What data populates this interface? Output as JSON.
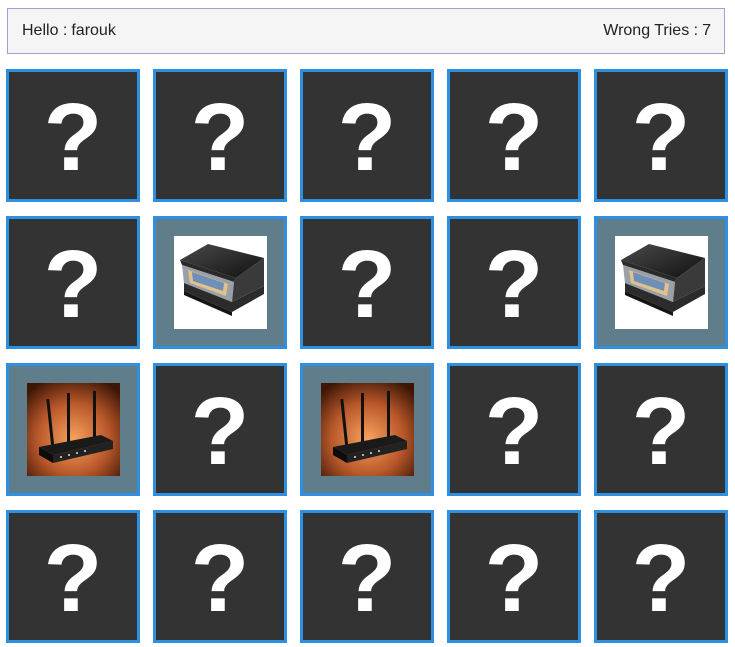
{
  "header": {
    "greeting_label": "Hello :",
    "player_name": "farouk",
    "wrong_tries_label": "Wrong Tries :",
    "wrong_tries_value": "7"
  },
  "board": {
    "hidden_symbol": "?",
    "cards": [
      {
        "state": "hidden"
      },
      {
        "state": "hidden"
      },
      {
        "state": "hidden"
      },
      {
        "state": "hidden"
      },
      {
        "state": "hidden"
      },
      {
        "state": "hidden"
      },
      {
        "state": "revealed",
        "image": "scanner"
      },
      {
        "state": "hidden"
      },
      {
        "state": "hidden"
      },
      {
        "state": "revealed",
        "image": "scanner"
      },
      {
        "state": "revealed",
        "image": "router"
      },
      {
        "state": "hidden"
      },
      {
        "state": "revealed",
        "image": "router"
      },
      {
        "state": "hidden"
      },
      {
        "state": "hidden"
      },
      {
        "state": "hidden"
      },
      {
        "state": "hidden"
      },
      {
        "state": "hidden"
      },
      {
        "state": "hidden"
      },
      {
        "state": "hidden"
      }
    ]
  },
  "colors": {
    "card_border": "#2f8fe0",
    "card_hidden_bg": "#333333",
    "card_revealed_bg": "#607d8b",
    "header_bg": "#f5f5f5",
    "header_border": "#9fa0d4"
  }
}
